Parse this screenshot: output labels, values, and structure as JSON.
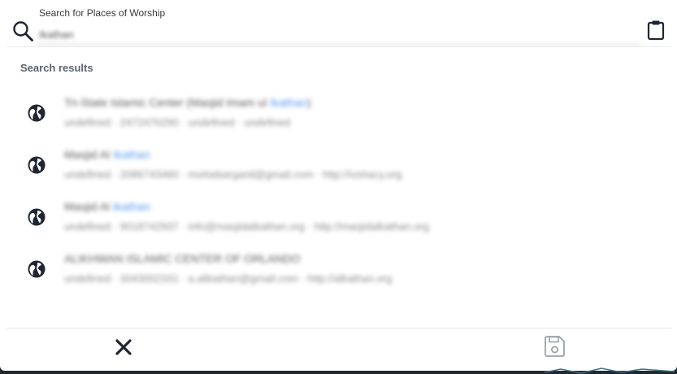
{
  "search": {
    "label": "Search for Places of Worship",
    "value": "Ikathan"
  },
  "results_heading": "Search results",
  "results": [
    {
      "icon": "globe-icon",
      "title_prefix": "Tri-State Islamic Center (Masjid Imam ul ",
      "title_highlight": "Ikathan",
      "title_suffix": ")",
      "subtitle": "undefined · 2472470290 · undefined · undefined"
    },
    {
      "icon": "globe-icon",
      "title_prefix": "Masjid Al ",
      "title_highlight": "Ikathan",
      "title_suffix": "",
      "subtitle": "undefined · 2086743460 · mohiebarganil@gmail.com · http://ivshacy.org"
    },
    {
      "icon": "globe-icon",
      "title_prefix": "Masjid Al ",
      "title_highlight": "Ikathan",
      "title_suffix": "",
      "subtitle": "undefined · 9018742937 · info@masjidalkathan.org · http://masjidalkathan.org"
    },
    {
      "icon": "globe-icon",
      "title_prefix": "ALIKHWAN ISLAMIC CENTER OF ORLANDO",
      "title_highlight": "",
      "title_suffix": "",
      "subtitle": "undefined · 3043002331 · a.alikathan@gmail.com · http://alkathan.org"
    }
  ],
  "footer": {
    "close_icon": "close-icon",
    "save_icon": "save-icon"
  },
  "colors": {
    "highlight": "#1a73e8",
    "heading": "#5b6470",
    "icon": "#1f2630",
    "save_disabled": "#9aa2ab"
  }
}
